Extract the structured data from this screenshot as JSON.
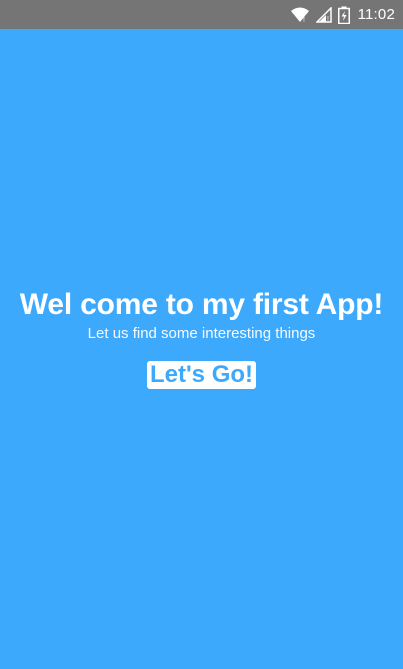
{
  "status_bar": {
    "time": "11:02",
    "icons": [
      "wifi-icon",
      "signal-icon",
      "battery-charging-icon"
    ],
    "background": "#757575"
  },
  "main": {
    "title": "Wel come to my first App!",
    "subtitle": "Let us find some interesting things",
    "button_label": "Let's Go!",
    "background": "#3da9fc",
    "accent": "#3da9fc"
  }
}
